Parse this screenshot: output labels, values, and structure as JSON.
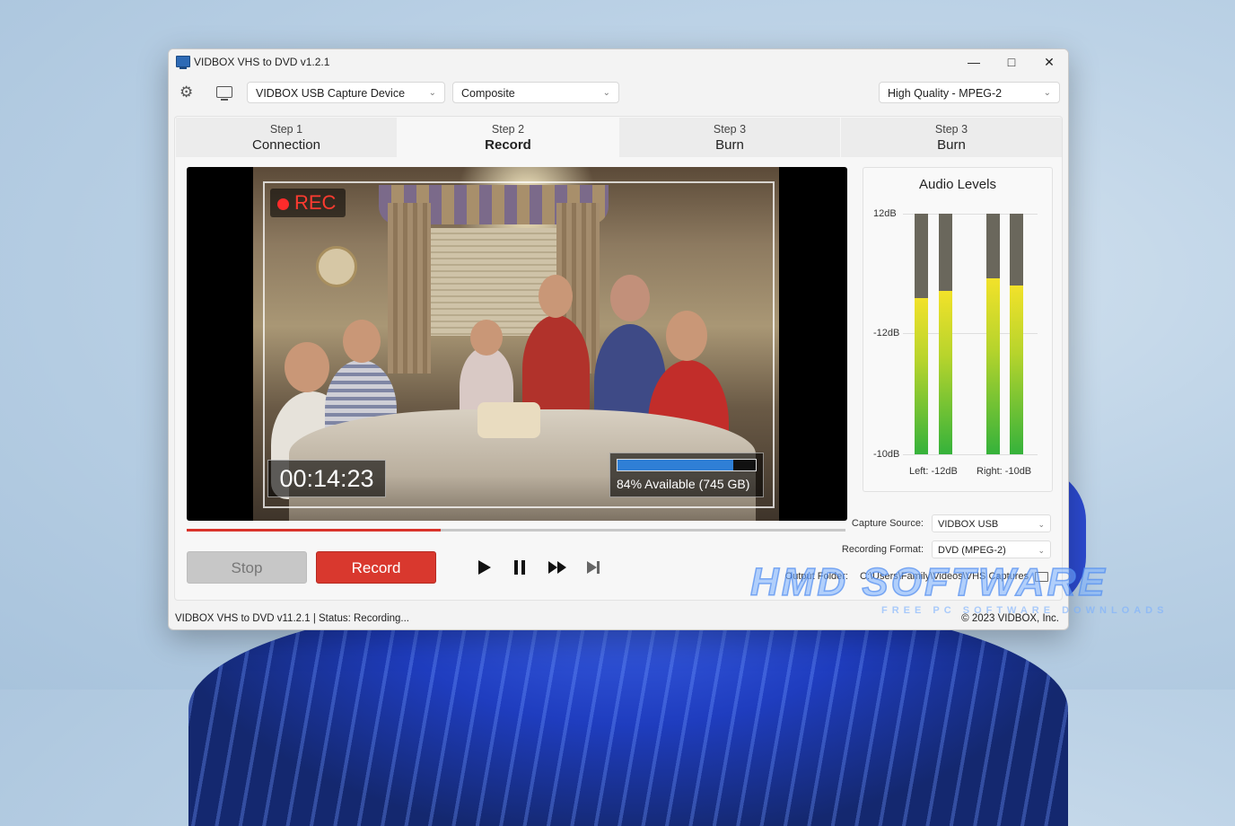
{
  "window": {
    "title": "VIDBOX VHS to DVD v1.2.1"
  },
  "toolbar": {
    "device": "VIDBOX USB Capture Device",
    "input": "Composite",
    "quality": "High Quality - MPEG-2"
  },
  "tabs": [
    {
      "step": "Step 1",
      "name": "Connection"
    },
    {
      "step": "Step 2",
      "name": "Record"
    },
    {
      "step": "Step 3",
      "name": "Burn"
    },
    {
      "step": "Step 3",
      "name": "Burn"
    }
  ],
  "video": {
    "rec_label": "REC",
    "timecode": "00:14:23",
    "available_text": "84% Available (745 GB)",
    "available_fraction": 0.84,
    "progress_fraction": 0.385
  },
  "controls": {
    "stop": "Stop",
    "record": "Record"
  },
  "audio": {
    "title": "Audio Levels",
    "ticks": [
      "12dB",
      "-12dB",
      "-10dB"
    ],
    "meters": [
      0.65,
      0.68,
      0.73,
      0.7
    ],
    "left_label": "Left: -12dB",
    "right_label": "Right: -10dB"
  },
  "settings": {
    "capture_source_label": "Capture Source:",
    "capture_source_value": "VIDBOX USB",
    "recording_format_label": "Recording Format:",
    "recording_format_value": "DVD (MPEG-2)",
    "output_folder_label": "Output Folder:",
    "output_folder_value": "C:\\Users\\Family\\Videos\\VHS Captures"
  },
  "status": {
    "left": "VIDBOX VHS to DVD v11.2.1 | Status: Recording...",
    "right": "© 2023 VIDBOX, Inc."
  },
  "watermark": {
    "brand": "HMD SOFTWARE",
    "tagline": "FREE PC SOFTWARE DOWNLOADS"
  }
}
